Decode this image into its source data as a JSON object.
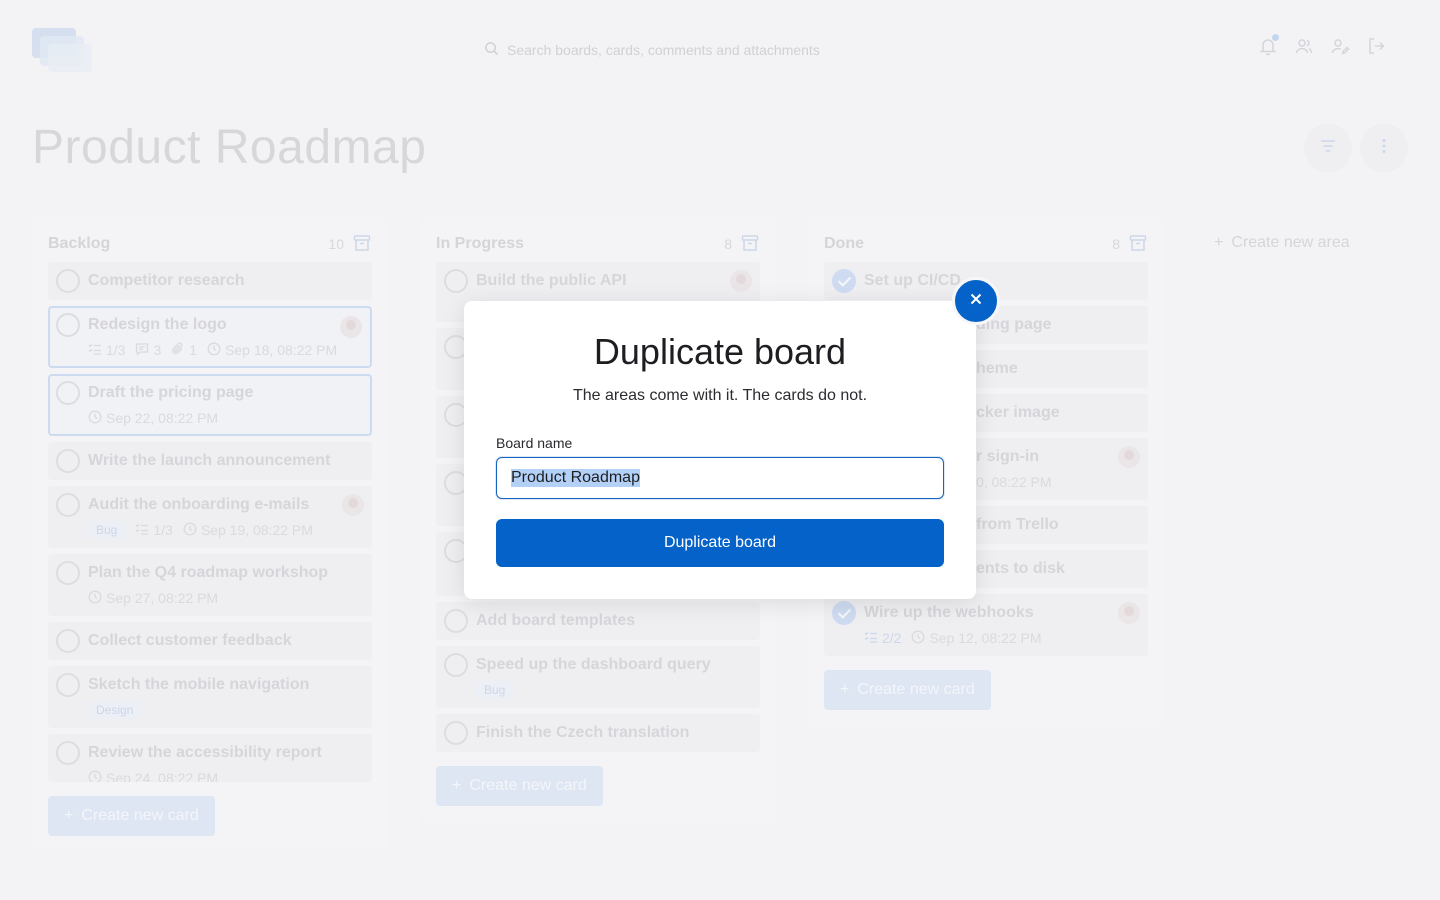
{
  "search": {
    "placeholder": "Search boards, cards, comments and attachments"
  },
  "header": {
    "board_title": "Product Roadmap"
  },
  "columns": [
    {
      "title": "Backlog",
      "count": "10",
      "cards": [
        {
          "title": "Competitor research"
        },
        {
          "title": "Redesign the logo",
          "checklist": "1/3",
          "comments": "3",
          "attachments": "1",
          "due": "Sep 18, 08:22 PM"
        },
        {
          "title": "Draft the pricing page",
          "due": "Sep 22, 08:22 PM"
        },
        {
          "title": "Write the launch announcement"
        },
        {
          "title": "Audit the onboarding e-mails",
          "tag": "Bug",
          "checklist": "1/3",
          "due": "Sep 19, 08:22 PM"
        },
        {
          "title": "Plan the Q4 roadmap workshop",
          "due": "Sep 27, 08:22 PM"
        },
        {
          "title": "Collect customer feedback"
        },
        {
          "title": "Sketch the mobile navigation",
          "tag": "Design"
        },
        {
          "title": "Review the accessibility report",
          "due": "Sep 24, 08:22 PM"
        }
      ],
      "create_label": "Create new card"
    },
    {
      "title": "In Progress",
      "count": "8",
      "cards": [
        {
          "title": "Build the public API"
        },
        {
          "title": "Add board templates"
        },
        {
          "title": "Speed up the dashboard query",
          "tag": "Bug"
        },
        {
          "title": "Finish the Czech translation"
        }
      ],
      "create_label": "Create new card"
    },
    {
      "title": "Done",
      "count": "8",
      "cards": [
        {
          "title": "Set up CI/CD"
        },
        {
          "title_fragment": "ding page"
        },
        {
          "title_fragment": "heme"
        },
        {
          "title_fragment": "cker image"
        },
        {
          "title_fragment": "r sign-in",
          "due_fragment": "0, 08:22 PM"
        },
        {
          "title_fragment": "from Trello"
        },
        {
          "title_fragment": "ents to disk"
        },
        {
          "title": "Wire up the webhooks",
          "checklist": "2/2",
          "due": "Sep 12, 08:22 PM"
        }
      ],
      "create_label": "Create new card"
    }
  ],
  "create_area_label": "Create new area",
  "modal": {
    "title": "Duplicate board",
    "subtitle": "The areas come with it. The cards do not.",
    "field_label": "Board name",
    "field_value": "Product Roadmap",
    "submit_label": "Duplicate board"
  },
  "colors": {
    "primary": "#0562c8",
    "background": "#f2f2f3"
  }
}
